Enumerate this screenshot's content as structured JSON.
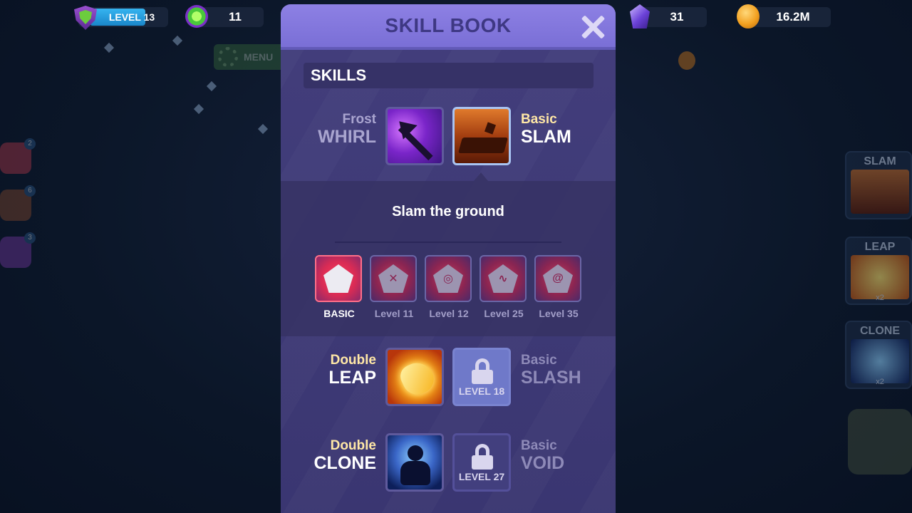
{
  "hud": {
    "level": "LEVEL 13",
    "level_progress": 0.75,
    "gems": "11",
    "crystals": "31",
    "coins": "16.2M"
  },
  "background": {
    "menu_label": "MENU",
    "right_cards": [
      {
        "label": "SLAM",
        "badge": ""
      },
      {
        "label": "LEAP",
        "badge": "x2"
      },
      {
        "label": "CLONE",
        "badge": "x2"
      }
    ],
    "left_badges": [
      "2",
      "6",
      "3"
    ]
  },
  "modal": {
    "title": "SKILL BOOK",
    "section": "SKILLS",
    "rows": [
      {
        "left": {
          "kind": "Frost",
          "name": "WHIRL"
        },
        "right": {
          "kind": "Basic",
          "name": "SLAM"
        }
      },
      {
        "left": {
          "kind": "Double",
          "name": "LEAP"
        },
        "right": {
          "kind": "Basic",
          "name": "SLASH",
          "lock": "LEVEL 18"
        }
      },
      {
        "left": {
          "kind": "Double",
          "name": "CLONE"
        },
        "right": {
          "kind": "Basic",
          "name": "VOID",
          "lock": "LEVEL 27"
        }
      }
    ],
    "detail": {
      "description": "Slam the ground",
      "upgrades": [
        "BASIC",
        "Level 11",
        "Level 12",
        "Level 25",
        "Level 35"
      ]
    }
  },
  "colors": {
    "header": "#7a6fd6",
    "modal_bg": "#3e3a73",
    "accent_blue": "#36b4f0",
    "active_red": "#d82b55"
  }
}
